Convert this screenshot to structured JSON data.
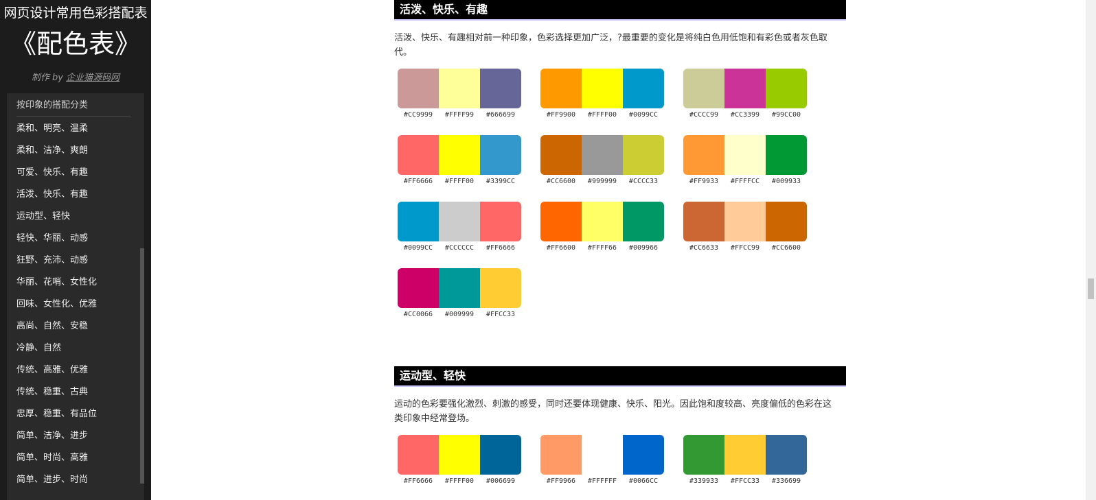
{
  "sidebar": {
    "title": "网页设计常用色彩搭配表",
    "big_title": "《配色表》",
    "credit_prefix": "制作 by",
    "credit_link": "企业猫源码网",
    "nav_heading": "按印象的搭配分类",
    "items": [
      "柔和、明亮、温柔",
      "柔和、洁净、爽朗",
      "可爱、快乐、有趣",
      "活泼、快乐、有趣",
      "运动型、轻快",
      "轻快、华丽、动感",
      "狂野、充沛、动感",
      "华丽、花哨、女性化",
      "回味、女性化、优雅",
      "高尚、自然、安稳",
      "冷静、自然",
      "传统、高雅、优雅",
      "传统、稳重、古典",
      "忠厚、稳重、有品位",
      "简单、洁净、进步",
      "简单、时尚、高雅",
      "简单、进步、时尚"
    ]
  },
  "sections": [
    {
      "title": "活泼、快乐、有趣",
      "description": "活泼、快乐、有趣相对前一种印象，色彩选择更加广泛，?最重要的变化是将纯白色用低饱和有彩色或者灰色取代。",
      "palettes": [
        [
          "#CC9999",
          "#FFFF99",
          "#666699"
        ],
        [
          "#FF9900",
          "#FFFF00",
          "#0099CC"
        ],
        [
          "#CCCC99",
          "#CC3399",
          "#99CC00"
        ],
        [
          "#FF6666",
          "#FFFF00",
          "#3399CC"
        ],
        [
          "#CC6600",
          "#999999",
          "#CCCC33"
        ],
        [
          "#FF9933",
          "#FFFFCC",
          "#009933"
        ],
        [
          "#0099CC",
          "#CCCCCC",
          "#FF6666"
        ],
        [
          "#FF6600",
          "#FFFF66",
          "#009966"
        ],
        [
          "#CC6633",
          "#FFCC99",
          "#CC6600"
        ],
        [
          "#CC0066",
          "#009999",
          "#FFCC33"
        ]
      ]
    },
    {
      "title": "运动型、轻快",
      "description": "运动的色彩要强化激烈、刺激的感受，同时还要体现健康、快乐、阳光。因此饱和度较高、亮度偏低的色彩在这类印象中经常登场。",
      "palettes": [
        [
          "#FF6666",
          "#FFFF00",
          "#006699"
        ],
        [
          "#FF9966",
          "#FFFFFF",
          "#0066CC"
        ],
        [
          "#339933",
          "#FFCC33",
          "#336699"
        ]
      ]
    }
  ]
}
